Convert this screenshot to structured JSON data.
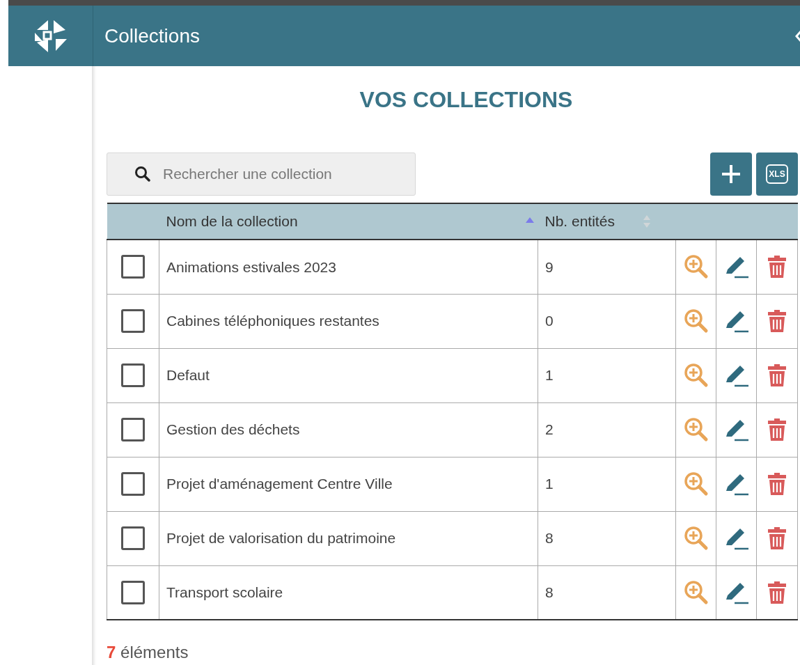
{
  "header": {
    "title": "Collections"
  },
  "page_title": "VOS COLLECTIONS",
  "search": {
    "placeholder": "Rechercher une collection"
  },
  "toolbar": {
    "export_label": "XLS"
  },
  "table": {
    "columns": [
      {
        "label": "Nom de la collection",
        "sorted": true
      },
      {
        "label": "Nb. entités",
        "sorted": false
      }
    ],
    "rows": [
      {
        "name": "Animations estivales 2023",
        "count": "9",
        "checked": false
      },
      {
        "name": "Cabines téléphoniques restantes",
        "count": "0",
        "checked": false
      },
      {
        "name": "Defaut",
        "count": "1",
        "checked": false
      },
      {
        "name": "Gestion des déchets",
        "count": "2",
        "checked": false
      },
      {
        "name": "Projet d'aménagement Centre Ville",
        "count": "1",
        "checked": false
      },
      {
        "name": "Projet de valorisation du patrimoine",
        "count": "8",
        "checked": false
      },
      {
        "name": "Transport scolaire",
        "count": "8",
        "checked": false
      }
    ]
  },
  "footer": {
    "count": "7",
    "label": "éléments"
  }
}
